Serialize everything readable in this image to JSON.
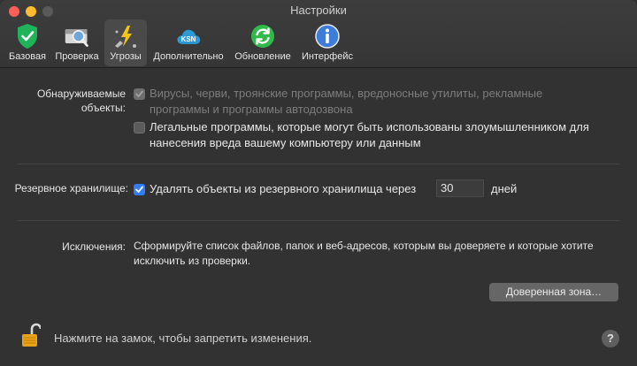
{
  "window": {
    "title": "Настройки"
  },
  "toolbar": {
    "tabs": [
      {
        "label": "Базовая",
        "icon": "shield-check-icon"
      },
      {
        "label": "Проверка",
        "icon": "scan-icon"
      },
      {
        "label": "Угрозы",
        "icon": "threat-bolt-icon"
      },
      {
        "label": "Дополнительно",
        "icon": "ksn-cloud-icon"
      },
      {
        "label": "Обновление",
        "icon": "update-icon"
      },
      {
        "label": "Интерфейс",
        "icon": "info-icon"
      }
    ],
    "selected": "Угрозы"
  },
  "detected": {
    "label": "Обнаруживаемые\nобъекты:",
    "option1": {
      "text": "Вирусы, черви, троянские программы, вредоносные утилиты, рекламные программы и программы автодозвона",
      "checked": true,
      "disabled": true
    },
    "option2": {
      "text": "Легальные программы, которые могут быть использованы злоумышленником для нанесения вреда вашему компьютеру или данным",
      "checked": false
    }
  },
  "backup": {
    "label": "Резервное хранилище:",
    "option_text": "Удалять объекты из резервного хранилища через",
    "checked": true,
    "days_value": "30",
    "days_unit": "дней"
  },
  "exclusions": {
    "label": "Исключения:",
    "description": "Сформируйте список файлов, папок и веб-адресов, которым вы доверяете и которые хотите исключить из проверки.",
    "button_label": "Доверенная зона…"
  },
  "footer": {
    "lock_text": "Нажмите на замок, чтобы запретить изменения.",
    "help_label": "?"
  },
  "colors": {
    "accent": "#2f7ef7",
    "shield": "#1fb35a",
    "update": "#2fba4a",
    "info": "#3b7dd8",
    "ksn": "#2a9ad6"
  }
}
